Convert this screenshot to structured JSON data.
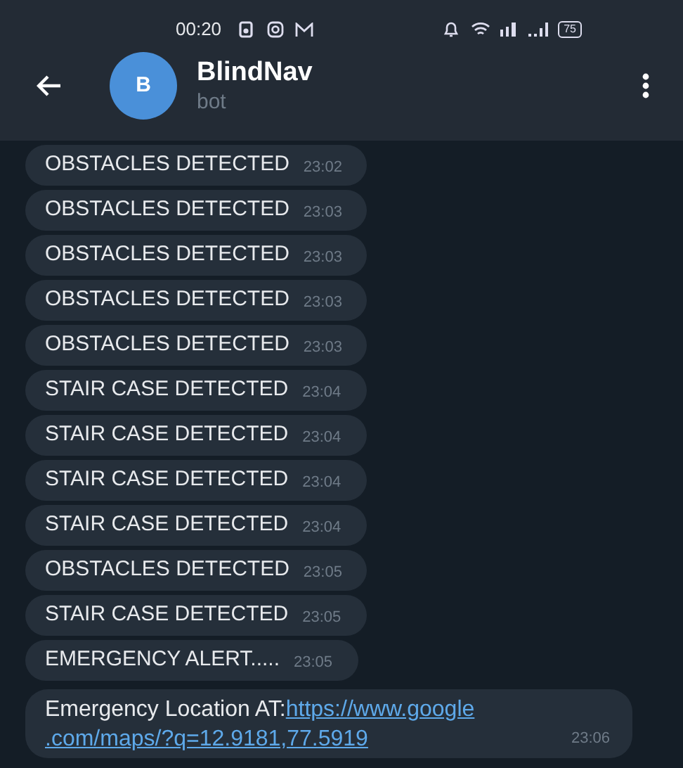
{
  "status_bar": {
    "time": "00:20",
    "battery": "75"
  },
  "header": {
    "title": "BlindNav",
    "subtitle": "bot",
    "avatar_letter": "B"
  },
  "messages": [
    {
      "text": "OBSTACLES DETECTED",
      "time": "23:02"
    },
    {
      "text": "OBSTACLES DETECTED",
      "time": "23:03"
    },
    {
      "text": "OBSTACLES DETECTED",
      "time": "23:03"
    },
    {
      "text": "OBSTACLES DETECTED",
      "time": "23:03"
    },
    {
      "text": "OBSTACLES DETECTED",
      "time": "23:03"
    },
    {
      "text": "STAIR CASE DETECTED",
      "time": "23:04"
    },
    {
      "text": "STAIR CASE DETECTED",
      "time": "23:04"
    },
    {
      "text": "STAIR CASE DETECTED",
      "time": "23:04"
    },
    {
      "text": "STAIR CASE DETECTED",
      "time": "23:04"
    },
    {
      "text": "OBSTACLES DETECTED",
      "time": "23:05"
    },
    {
      "text": "STAIR CASE DETECTED",
      "time": "23:05"
    },
    {
      "text": "EMERGENCY ALERT.....",
      "time": "23:05"
    },
    {
      "text": "Emergency Location AT:",
      "link_lines": [
        "https://www.google",
        ".com/maps/?q=12.9181,77.5919"
      ],
      "time": "23:06"
    }
  ]
}
